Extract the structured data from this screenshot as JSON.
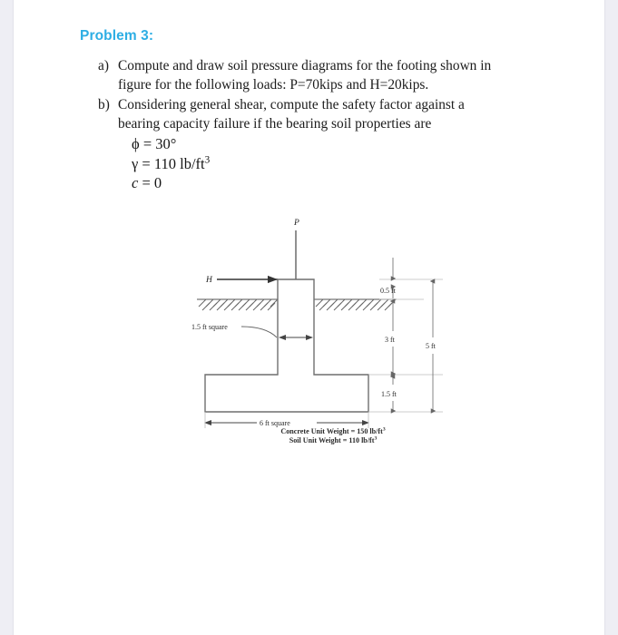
{
  "page": {
    "title": "Problem 3:",
    "title_color": "#2daee4"
  },
  "questions": [
    {
      "marker": "a)",
      "text": "Compute and draw soil pressure diagrams for the footing shown in",
      "text_last": "figure for the following loads: P=70kips and H=20kips."
    },
    {
      "marker": "b)",
      "text": "Considering general shear, compute the safety factor against a",
      "text_last": "bearing capacity failure if the bearing soil properties are"
    }
  ],
  "equations": [
    {
      "symbol": "ϕ",
      "operator": "=",
      "value": "30°"
    },
    {
      "symbol": "γ",
      "operator": "=",
      "value": "110 lb/ft",
      "exponent": "3"
    },
    {
      "symbol": "c",
      "operator": "=",
      "value": "0"
    }
  ],
  "figure": {
    "load_vertical": "P",
    "load_horizontal": "H",
    "column_label": "1.5 ft square",
    "base_label": "6 ft square",
    "dim_top": "0.5 ft",
    "dim_middle": "3 ft",
    "dim_bottom": "1.5 ft",
    "dim_total": "5 ft",
    "caption_line1_text": "Concrete Unit Weight = 150 lb/ft",
    "caption_line1_exp": "3",
    "caption_line2_text": "Soil Unit Weight = 110 lb/ft",
    "caption_line2_exp": "3",
    "outline_color": "#6f6f6f",
    "line_color": "#555555"
  }
}
